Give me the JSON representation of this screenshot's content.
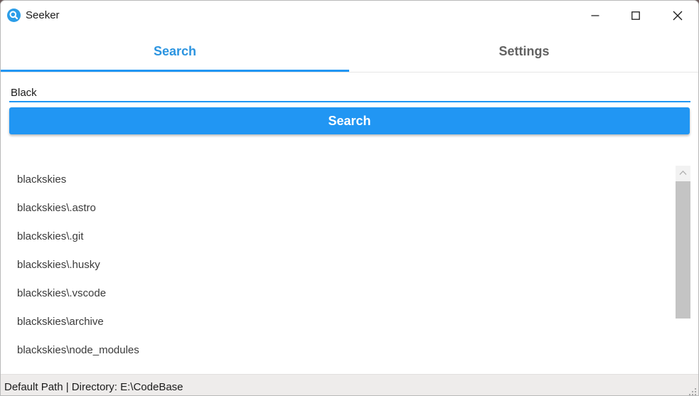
{
  "window": {
    "title": "Seeker",
    "app_icon": "magnifier-icon",
    "controls": [
      "minimize-icon",
      "maximize-icon",
      "close-icon"
    ]
  },
  "tabs": [
    {
      "label": "Search",
      "active": true
    },
    {
      "label": "Settings",
      "active": false
    }
  ],
  "search": {
    "value": "Black",
    "button_label": "Search"
  },
  "results": [
    "blackskies",
    "blackskies\\.astro",
    "blackskies\\.git",
    "blackskies\\.husky",
    "blackskies\\.vscode",
    "blackskies\\archive",
    "blackskies\\node_modules"
  ],
  "status": {
    "text": "Default Path | Directory: E:\\CodeBase"
  },
  "colors": {
    "accent": "#2196f3",
    "tab_active_text": "#2b94e0",
    "tab_inactive_text": "#616161",
    "status_bg": "#eeeceb"
  }
}
